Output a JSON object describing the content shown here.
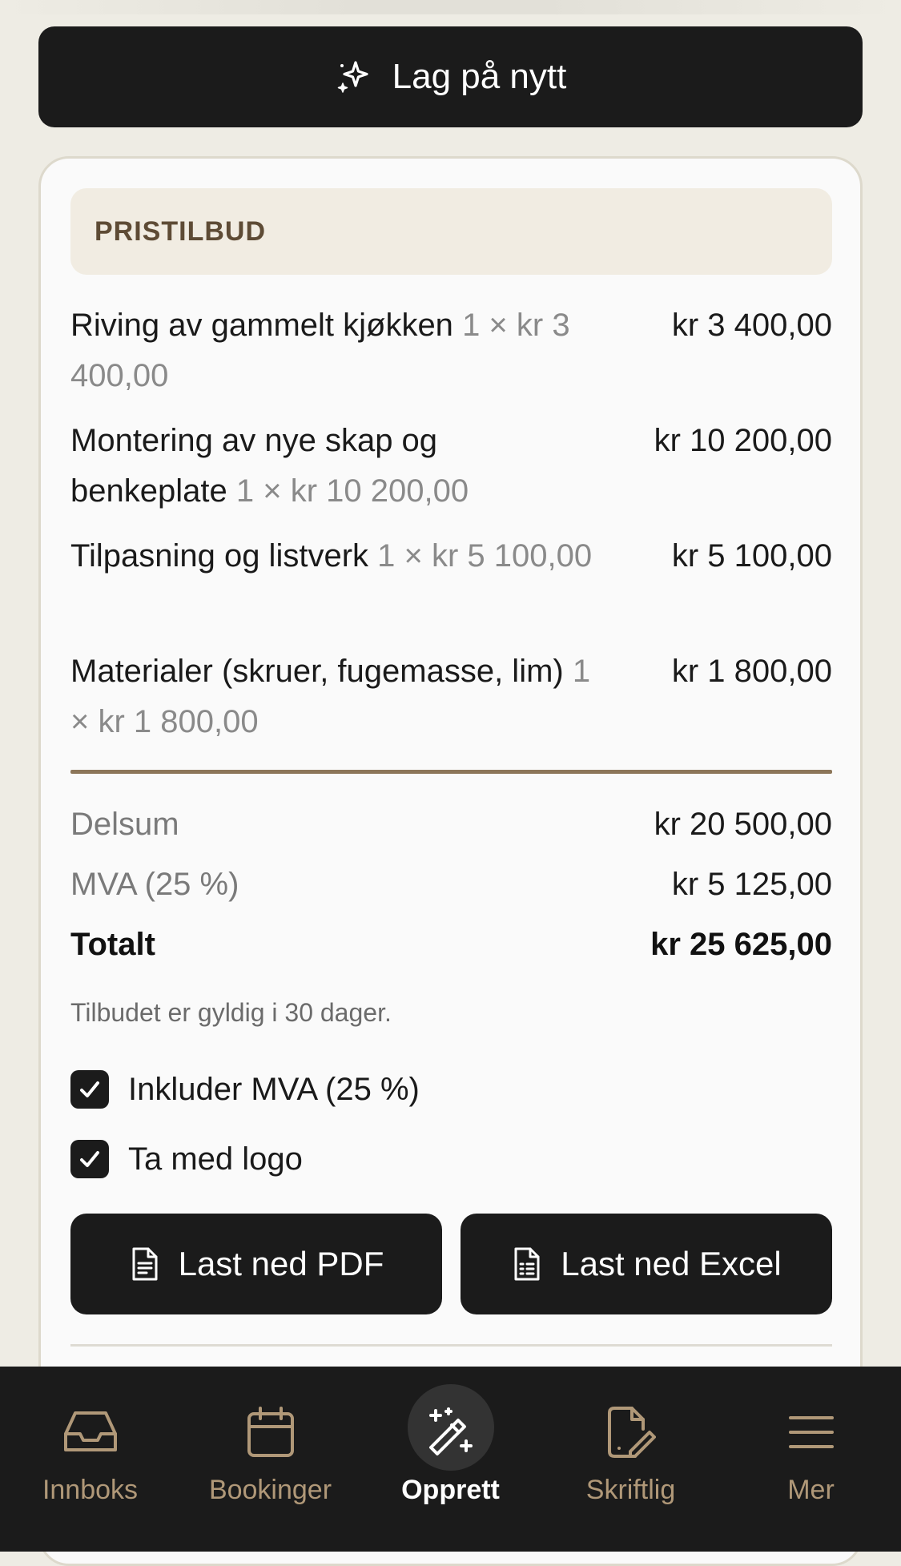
{
  "regenerate_label": "Lag på nytt",
  "quote": {
    "header": "PRISTILBUD",
    "items": [
      {
        "description": "Riving av gammelt kjøkken",
        "qty_text": "1 × kr 3 400,00",
        "amount": "kr 3 400,00"
      },
      {
        "description": "Montering av nye skap og benkeplate",
        "qty_text": "1 × kr 10 200,00",
        "amount": "kr 10 200,00"
      },
      {
        "description": "Tilpasning og listverk",
        "qty_text": "1 × kr 5 100,00",
        "amount": "kr 5 100,00"
      },
      {
        "description": "Materialer (skruer, fugemasse, lim)",
        "qty_text": "1 × kr 1 800,00",
        "amount": "kr 1 800,00"
      }
    ],
    "subtotal_label": "Delsum",
    "subtotal_value": "kr 20 500,00",
    "vat_label": "MVA (25 %)",
    "vat_value": "kr 5 125,00",
    "total_label": "Totalt",
    "total_value": "kr 25 625,00",
    "validity_note": "Tilbudet er gyldig i 30 dager.",
    "options": {
      "include_vat_label": "Inkluder MVA (25 %)",
      "include_vat_checked": true,
      "include_logo_label": "Ta med logo",
      "include_logo_checked": true
    },
    "download_pdf_label": "Last ned PDF",
    "download_excel_label": "Last ned Excel"
  },
  "nav": {
    "items": [
      {
        "label": "Innboks",
        "icon": "inbox-icon",
        "active": false
      },
      {
        "label": "Bookinger",
        "icon": "calendar-icon",
        "active": false
      },
      {
        "label": "Opprett",
        "icon": "magic-wand-icon",
        "active": true
      },
      {
        "label": "Skriftlig",
        "icon": "document-edit-icon",
        "active": false
      },
      {
        "label": "Mer",
        "icon": "menu-icon",
        "active": false
      }
    ]
  },
  "colors": {
    "background": "#eeece4",
    "dark": "#1b1b1b",
    "accent_brown": "#8c7659",
    "nav_label": "#b09878"
  }
}
